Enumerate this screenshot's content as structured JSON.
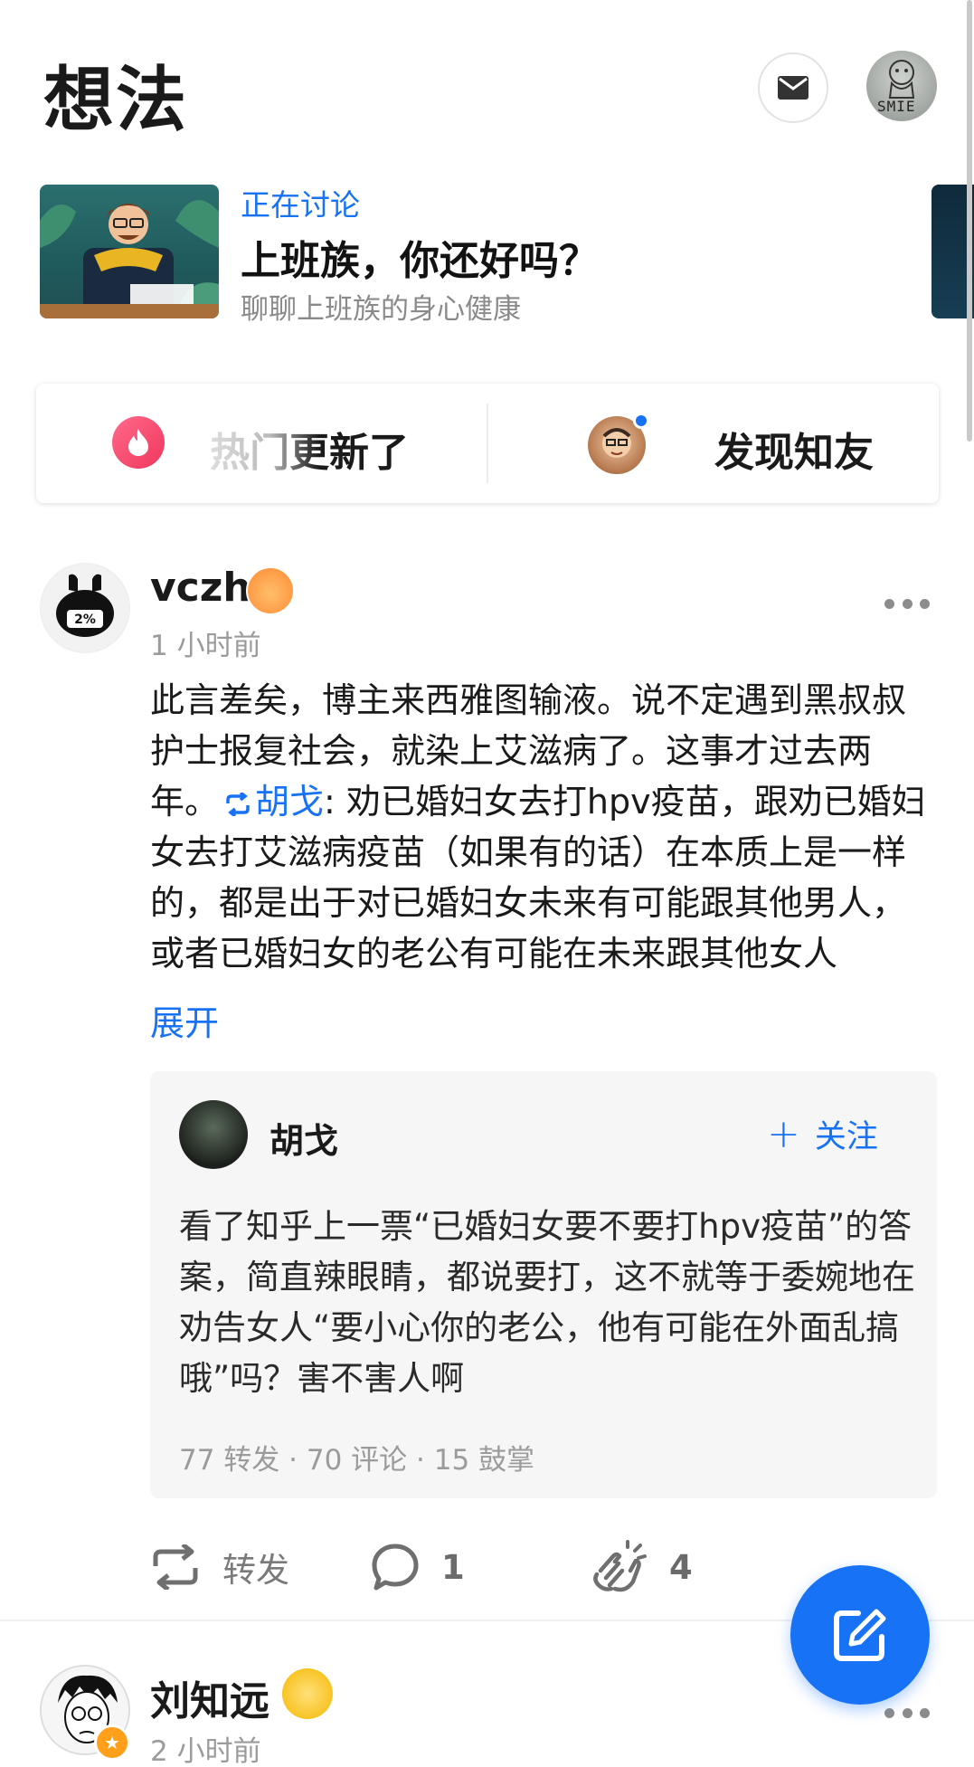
{
  "header": {
    "title": "想法",
    "mail_icon": "mail-icon",
    "profile_avatar_text": "SMIE"
  },
  "discussion": {
    "tag": "正在讨论",
    "title": "上班族，你还好吗？",
    "subtitle": "聊聊上班族的身心健康"
  },
  "action_card": {
    "hot_label": "热门更新了",
    "discover_label": "发现知友"
  },
  "post": {
    "author": "vczh",
    "time": "1 小时前",
    "avatar_text": "2%",
    "body_before": "此言差矣，博主来西雅图输液。说不定遇到黑叔叔护士报复社会，就染上艾滋病了。这事才过去两年。",
    "repost_ref": "胡戈",
    "body_after": ": 劝已婚妇女去打hpv疫苗，跟劝已婚妇女去打艾滋病疫苗（如果有的话）在本质上是一样的，都是出于对已婚妇女未来有可能跟其他男人，或者已婚妇女的老公有可能在未来跟其他女人",
    "expand_label": "展开",
    "quote": {
      "author": "胡戈",
      "follow_label": "关注",
      "text": "看了知乎上一票“已婚妇女要不要打hpv疫苗”的答案，简直辣眼睛，都说要打，这不就等于委婉地在劝告女人“要小心你的老公，他有可能在外面乱搞哦”吗？害不害人啊",
      "stats": "77 转发 · 70 评论 · 15 鼓掌"
    },
    "actions": {
      "repost_label": "转发",
      "comment_count": "1",
      "clap_count": "4"
    }
  },
  "post2": {
    "author": "刘知远",
    "time": "2 小时前"
  },
  "colors": {
    "accent": "#1772f6",
    "text_primary": "#1a1a1a",
    "text_secondary": "#9b9b9b",
    "quote_bg": "#f6f6f6"
  }
}
